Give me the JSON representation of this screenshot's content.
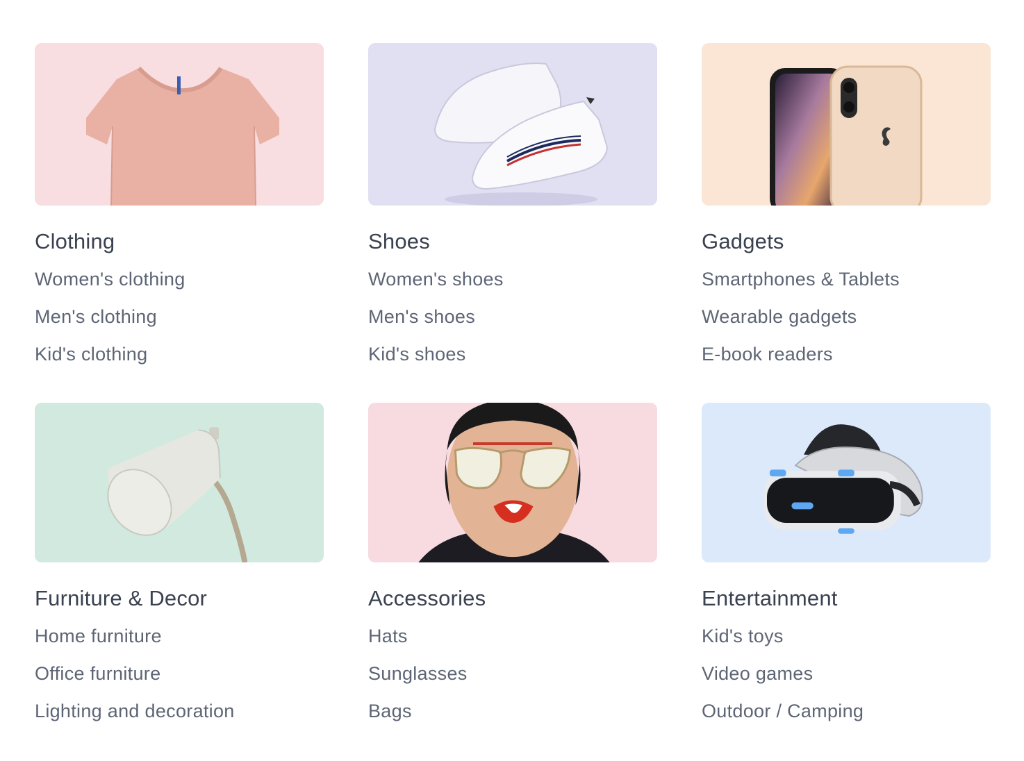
{
  "categories": [
    {
      "title": "Clothing",
      "image": "t-shirt-photo",
      "bg": "#f8dde1",
      "links": [
        "Women's clothing",
        "Men's clothing",
        "Kid's clothing"
      ]
    },
    {
      "title": "Shoes",
      "image": "sneakers-photo",
      "bg": "#e1e0f3",
      "links": [
        "Women's shoes",
        "Men's shoes",
        "Kid's shoes"
      ]
    },
    {
      "title": "Gadgets",
      "image": "smartphones-photo",
      "bg": "#fbe6d6",
      "links": [
        "Smartphones & Tablets",
        "Wearable gadgets",
        "E-book readers"
      ]
    },
    {
      "title": "Furniture & Decor",
      "image": "desk-lamp-photo",
      "bg": "#d1e9df",
      "links": [
        "Home furniture",
        "Office furniture",
        "Lighting and decoration"
      ]
    },
    {
      "title": "Accessories",
      "image": "sunglasses-model-photo",
      "bg": "#f7dbe1",
      "links": [
        "Hats",
        "Sunglasses",
        "Bags"
      ]
    },
    {
      "title": "Entertainment",
      "image": "vr-headset-photo",
      "bg": "#dce9fb",
      "links": [
        "Kid's toys",
        "Video games",
        "Outdoor / Camping"
      ]
    }
  ]
}
